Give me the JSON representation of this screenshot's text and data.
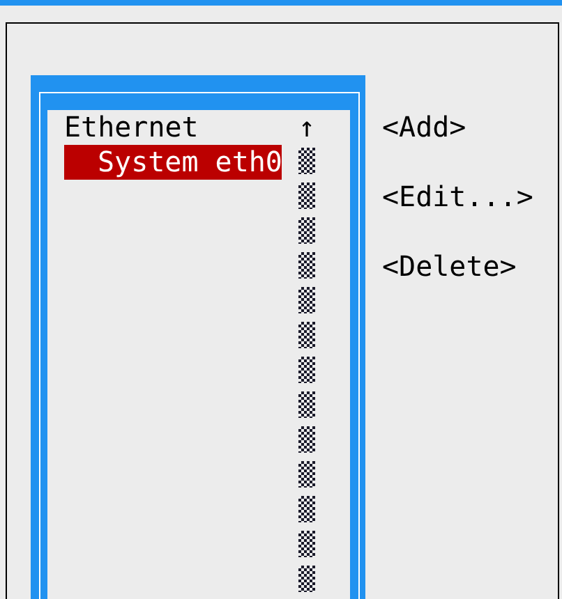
{
  "connection_list": {
    "scroll_up_arrow": "↑",
    "groups": [
      {
        "label": "Ethernet",
        "kind": "header",
        "children": [
          {
            "label": "System eth0",
            "selected": true
          }
        ]
      }
    ]
  },
  "buttons": [
    "<Add>",
    "<Edit...>",
    "<Delete>"
  ]
}
